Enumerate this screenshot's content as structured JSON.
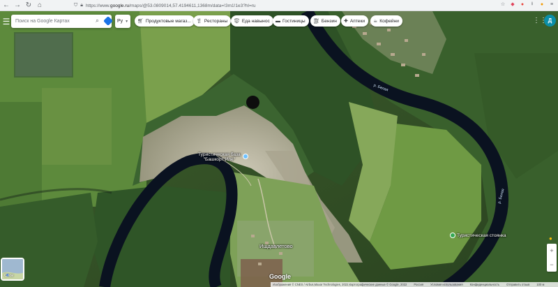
{
  "browser": {
    "url_prefix": "https://www.",
    "url_host": "google.ru",
    "url_rest": "/maps/@53.0809014,57.4194611,1368m/data=!3m1!1e3?hl=ru",
    "back_icon": "back-arrow-icon",
    "forward_icon": "forward-arrow-icon",
    "reload_icon": "reload-icon",
    "home_icon": "home-icon"
  },
  "toolbar": {
    "search_placeholder": "Поиск на Google Картах",
    "language": "Ру",
    "chips": [
      {
        "icon": "cart-icon",
        "label": "Продуктовые магаз..."
      },
      {
        "icon": "fork-knife-icon",
        "label": "Рестораны"
      },
      {
        "icon": "takeaway-icon",
        "label": "Еда навынос"
      },
      {
        "icon": "bed-icon",
        "label": "Гостиницы"
      },
      {
        "icon": "fuel-icon",
        "label": "Бензин"
      },
      {
        "icon": "pharmacy-icon",
        "label": "Аптеки"
      },
      {
        "icon": "coffee-icon",
        "label": "Кофейни"
      }
    ],
    "avatar_letter": "Д"
  },
  "map": {
    "river_labels": [
      "р. Белая",
      "р. Белая"
    ],
    "place_labels": {
      "base_line1": "Туристическая база",
      "base_line2": "\"Башкорт Иле\"",
      "stoyanka": "Туристическая стоянка",
      "village": "Ишдавлетово"
    },
    "layers_label": "Слои",
    "logo": "Google",
    "footer": [
      "Изображения © CNES / Airbus,Maxar Technologies, 2022,Картографические данные © Google, 2022",
      "Россия",
      "Условия использования",
      "Конфиденциальность",
      "Отправить отзыв",
      "100 м"
    ],
    "colors": {
      "river": "#0a1220",
      "forest_dark": "#2d4a22",
      "meadow": "#5f8a3a",
      "rock": "#b7b3a2"
    }
  }
}
